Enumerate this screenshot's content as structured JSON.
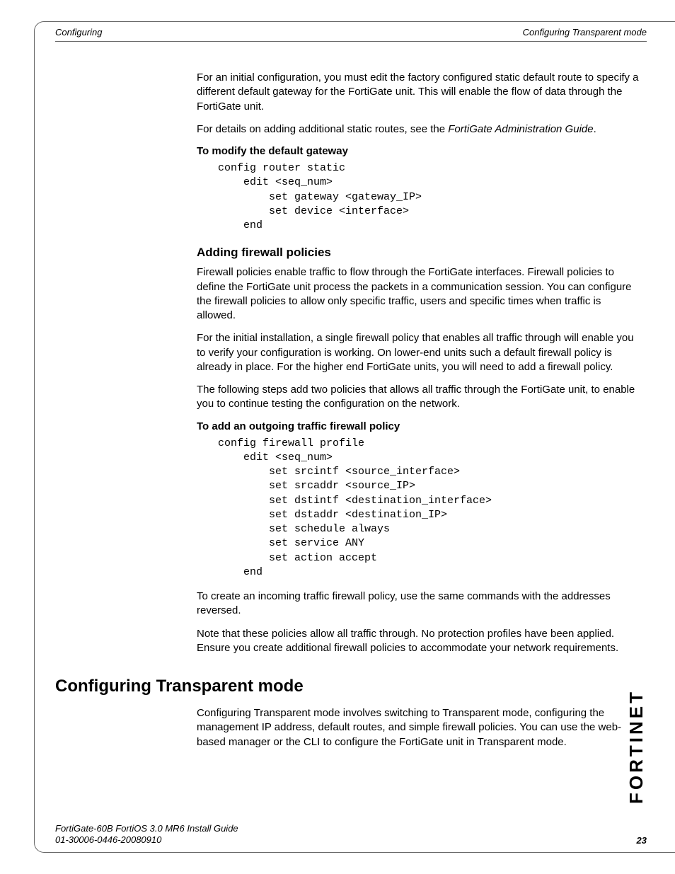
{
  "header": {
    "left": "Configuring",
    "right": "Configuring Transparent mode"
  },
  "body": {
    "p1": "For an initial configuration, you must edit the factory configured static default route to specify a different default gateway for the FortiGate unit. This will enable the flow of data through the FortiGate unit.",
    "p2_a": "For details on adding additional static routes, see the ",
    "p2_i": "FortiGate Administration Guide",
    "p2_b": ".",
    "sub1": "To modify the default gateway",
    "code1": "config router static\n    edit <seq_num>\n        set gateway <gateway_IP>\n        set device <interface>\n    end",
    "h3": "Adding firewall policies",
    "p3": "Firewall policies enable traffic to flow through the FortiGate interfaces. Firewall policies to define the FortiGate unit process the packets in a communication session. You can configure the firewall policies to allow only specific traffic, users and specific times when traffic is allowed.",
    "p4": "For the initial installation, a single firewall policy that enables all traffic through will enable you to verify your configuration is working. On lower-end units such a default firewall policy is already in place. For the higher end FortiGate units, you will need to add a firewall policy.",
    "p5": "The following steps add two policies that allows all traffic through the FortiGate unit, to enable you to continue testing the configuration on the network.",
    "sub2": "To add an outgoing traffic firewall policy",
    "code2": "config firewall profile\n    edit <seq_num>\n        set srcintf <source_interface>\n        set srcaddr <source_IP>\n        set dstintf <destination_interface>\n        set dstaddr <destination_IP>\n        set schedule always\n        set service ANY\n        set action accept\n    end",
    "p6": "To create an incoming traffic firewall policy, use the same commands with the addresses reversed.",
    "p7": "Note that these policies allow all traffic through. No protection profiles have been applied. Ensure you create additional firewall policies to accommodate your network requirements.",
    "h2": "Configuring Transparent mode",
    "p8": "Configuring Transparent mode involves switching to Transparent mode, configuring the management IP address, default routes, and simple firewall policies. You can use the web-based manager or the CLI to configure the FortiGate unit in Transparent mode."
  },
  "footer": {
    "line1": "FortiGate-60B FortiOS 3.0 MR6 Install Guide",
    "line2": "01-30006-0446-20080910",
    "page": "23"
  },
  "logo": "FORTINET"
}
